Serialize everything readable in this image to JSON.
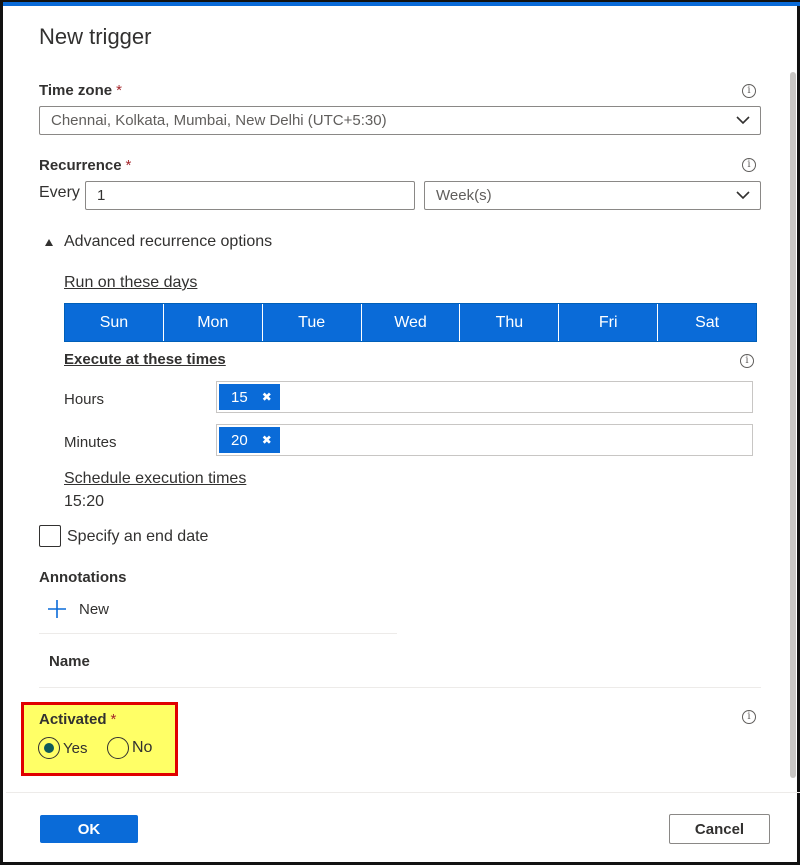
{
  "dialog": {
    "title": "New trigger"
  },
  "time_zone": {
    "label": "Time zone",
    "required_mark": "*",
    "value": "Chennai, Kolkata, Mumbai, New Delhi (UTC+5:30)"
  },
  "recurrence": {
    "label": "Recurrence",
    "required_mark": "*",
    "every_label": "Every",
    "interval_value": "1",
    "unit_value": "Week(s)"
  },
  "advanced": {
    "toggle_label": "Advanced recurrence options",
    "days_link": "Run on these days",
    "days": [
      "Sun",
      "Mon",
      "Tue",
      "Wed",
      "Thu",
      "Fri",
      "Sat"
    ],
    "times_link": "Execute at these times",
    "hours_label": "Hours",
    "hours_chips": [
      "15"
    ],
    "minutes_label": "Minutes",
    "minutes_chips": [
      "20"
    ],
    "schedule_link": "Schedule execution times",
    "schedule_value": "15:20"
  },
  "end_date": {
    "label": "Specify an end date",
    "checked": false
  },
  "annotations": {
    "label": "Annotations",
    "new_label": "New",
    "name_header": "Name"
  },
  "activated": {
    "label": "Activated",
    "required_mark": "*",
    "options": [
      "Yes",
      "No"
    ],
    "selected": "Yes"
  },
  "footer": {
    "ok_label": "OK",
    "cancel_label": "Cancel"
  },
  "icons": {
    "info": "i",
    "chip_remove": "✖",
    "plus": "+",
    "triangle": "◢"
  },
  "colors": {
    "accent": "#0a6bd8",
    "required": "#a4262c",
    "highlight_fill": "#ffff66",
    "highlight_border": "#e00000"
  }
}
